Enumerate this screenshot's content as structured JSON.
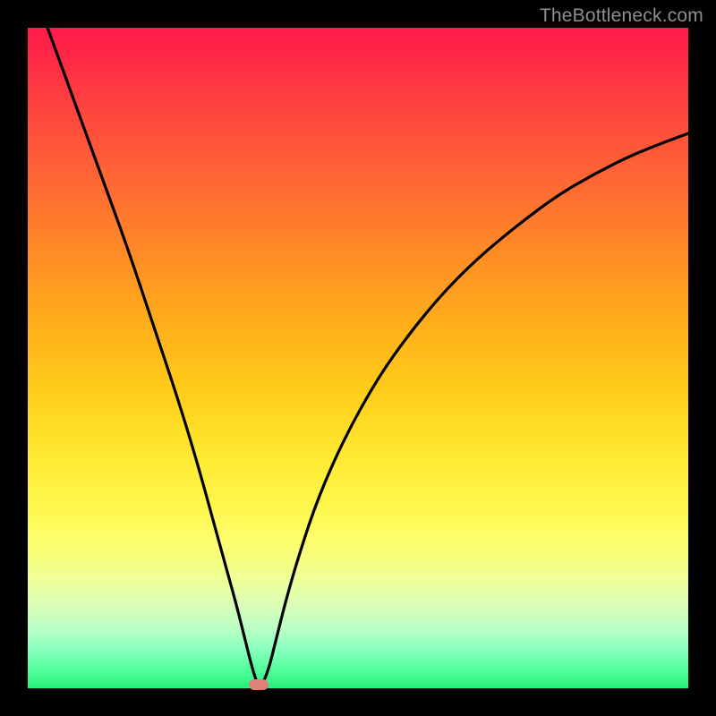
{
  "watermark": "TheBottleneck.com",
  "chart_data": {
    "type": "line",
    "title": "",
    "xlabel": "",
    "ylabel": "",
    "xlim": [
      0,
      100
    ],
    "ylim": [
      0,
      100
    ],
    "grid": false,
    "legend": false,
    "series": [
      {
        "name": "bottleneck-curve",
        "x": [
          3,
          7,
          11,
          15,
          19,
          23,
          26,
          29,
          31.5,
          33,
          34,
          34.8,
          35.5,
          36.5,
          37.5,
          39,
          41,
          44,
          48,
          53,
          58,
          63,
          68,
          74,
          80,
          86,
          92,
          100
        ],
        "y": [
          100,
          89,
          78,
          67,
          55,
          43,
          33,
          22,
          13,
          7,
          3,
          0.5,
          0.5,
          3,
          7,
          13,
          20,
          29,
          38,
          47,
          54,
          60,
          65,
          70,
          74.5,
          78,
          81,
          84
        ]
      }
    ],
    "minimum_marker": {
      "x": 35,
      "y": 0.5
    },
    "gradient_stops": [
      {
        "pct": 0,
        "color": "#ff1a49"
      },
      {
        "pct": 24,
        "color": "#ff6a33"
      },
      {
        "pct": 55,
        "color": "#ffcd19"
      },
      {
        "pct": 78,
        "color": "#fdff6e"
      },
      {
        "pct": 100,
        "color": "#25f07a"
      }
    ]
  }
}
